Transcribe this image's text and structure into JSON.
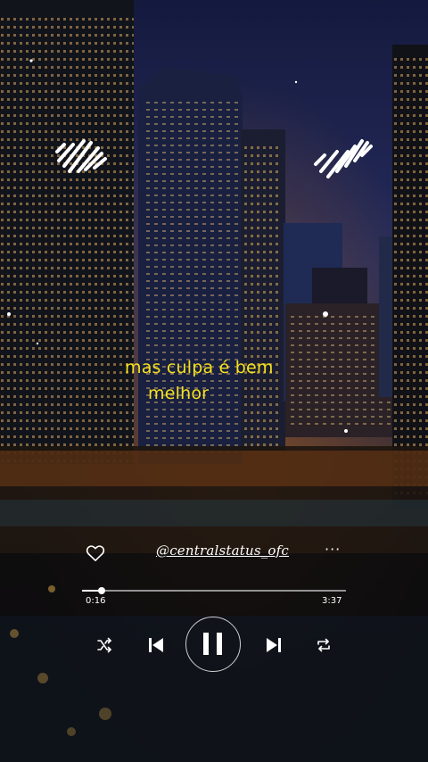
{
  "lyrics": {
    "line1": "mas culpa é bem",
    "line2": "melhor"
  },
  "handle": "@centralstatus_ofc",
  "more_label": "···",
  "player": {
    "current_time": "0:16",
    "duration": "3:37",
    "progress_fraction": 0.074,
    "state": "playing"
  },
  "colors": {
    "lyrics": "#f5e21c",
    "controls": "#ffffff"
  },
  "icons": {
    "like": "heart-icon",
    "more": "more-icon",
    "shuffle": "shuffle-icon",
    "previous": "previous-icon",
    "play_pause": "pause-icon",
    "next": "next-icon",
    "repeat": "repeat-icon",
    "sound_wave": "sound-wave-icon"
  }
}
